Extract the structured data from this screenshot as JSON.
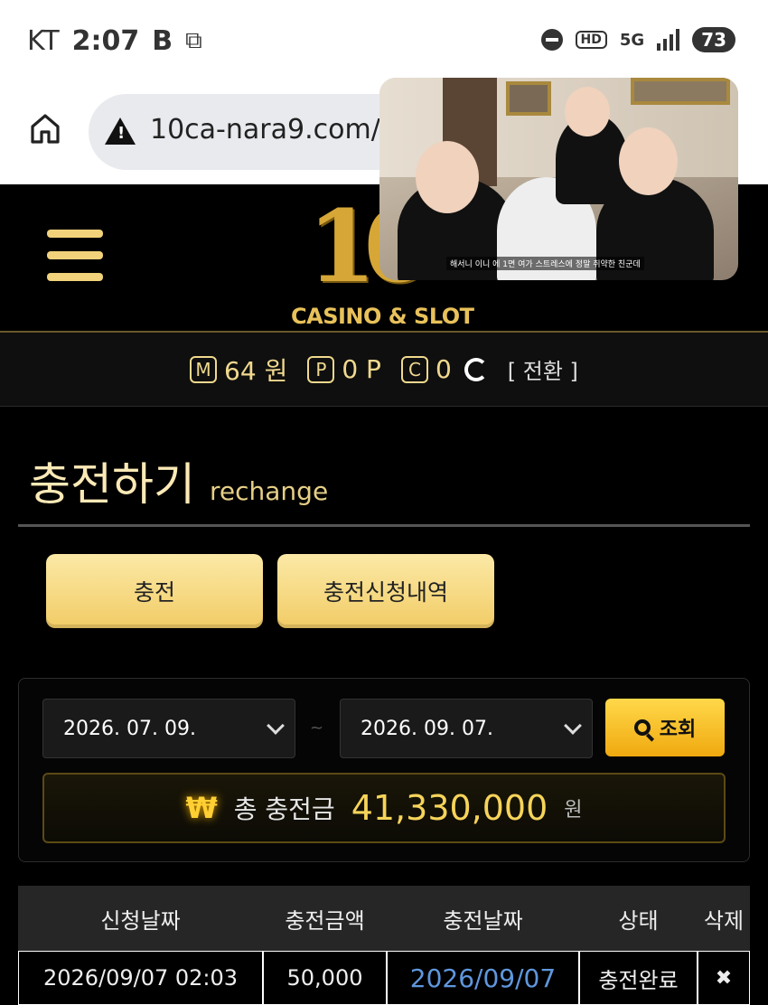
{
  "status_bar": {
    "carrier": "KT",
    "time": "2:07",
    "battery": "73",
    "network": "5G",
    "hd": "HD"
  },
  "browser": {
    "url": "10ca-nara9.com/"
  },
  "video_overlay": {
    "caption": "해서니  이니 에 1면 여가 스트레스에 정말 취약한 친군데"
  },
  "header": {
    "logo_number": "10",
    "logo_text": "CASINO & SLOT"
  },
  "points": {
    "m_badge": "M",
    "m_value": "64 원",
    "p_badge": "P",
    "p_value": "0 P",
    "c_badge": "C",
    "c_value": "0",
    "switch_label": "[ 전환 ]"
  },
  "page": {
    "title_ko": "충전하기",
    "title_en": "rechange"
  },
  "tabs": {
    "charge": "충전",
    "history": "충전신청내역"
  },
  "search": {
    "from_date": "2026. 07. 09.",
    "to_date": "2026. 09. 07.",
    "separator": "~",
    "button": "조회"
  },
  "total": {
    "currency_symbol": "₩",
    "label": "총 충전금",
    "value": "41,330,000",
    "unit": "원"
  },
  "table": {
    "headers": [
      "신청날짜",
      "충전금액",
      "충전날짜",
      "상태",
      "삭제"
    ],
    "rows": [
      {
        "requested": "2026/09/07 02:03",
        "amount": "50,000",
        "charged": "2026/09/07",
        "status": "충전완료",
        "delete": "✖"
      }
    ]
  },
  "colors": {
    "gold": "#f2cc66",
    "accent": "#ffcf33",
    "link_blue": "#5f97dd"
  }
}
